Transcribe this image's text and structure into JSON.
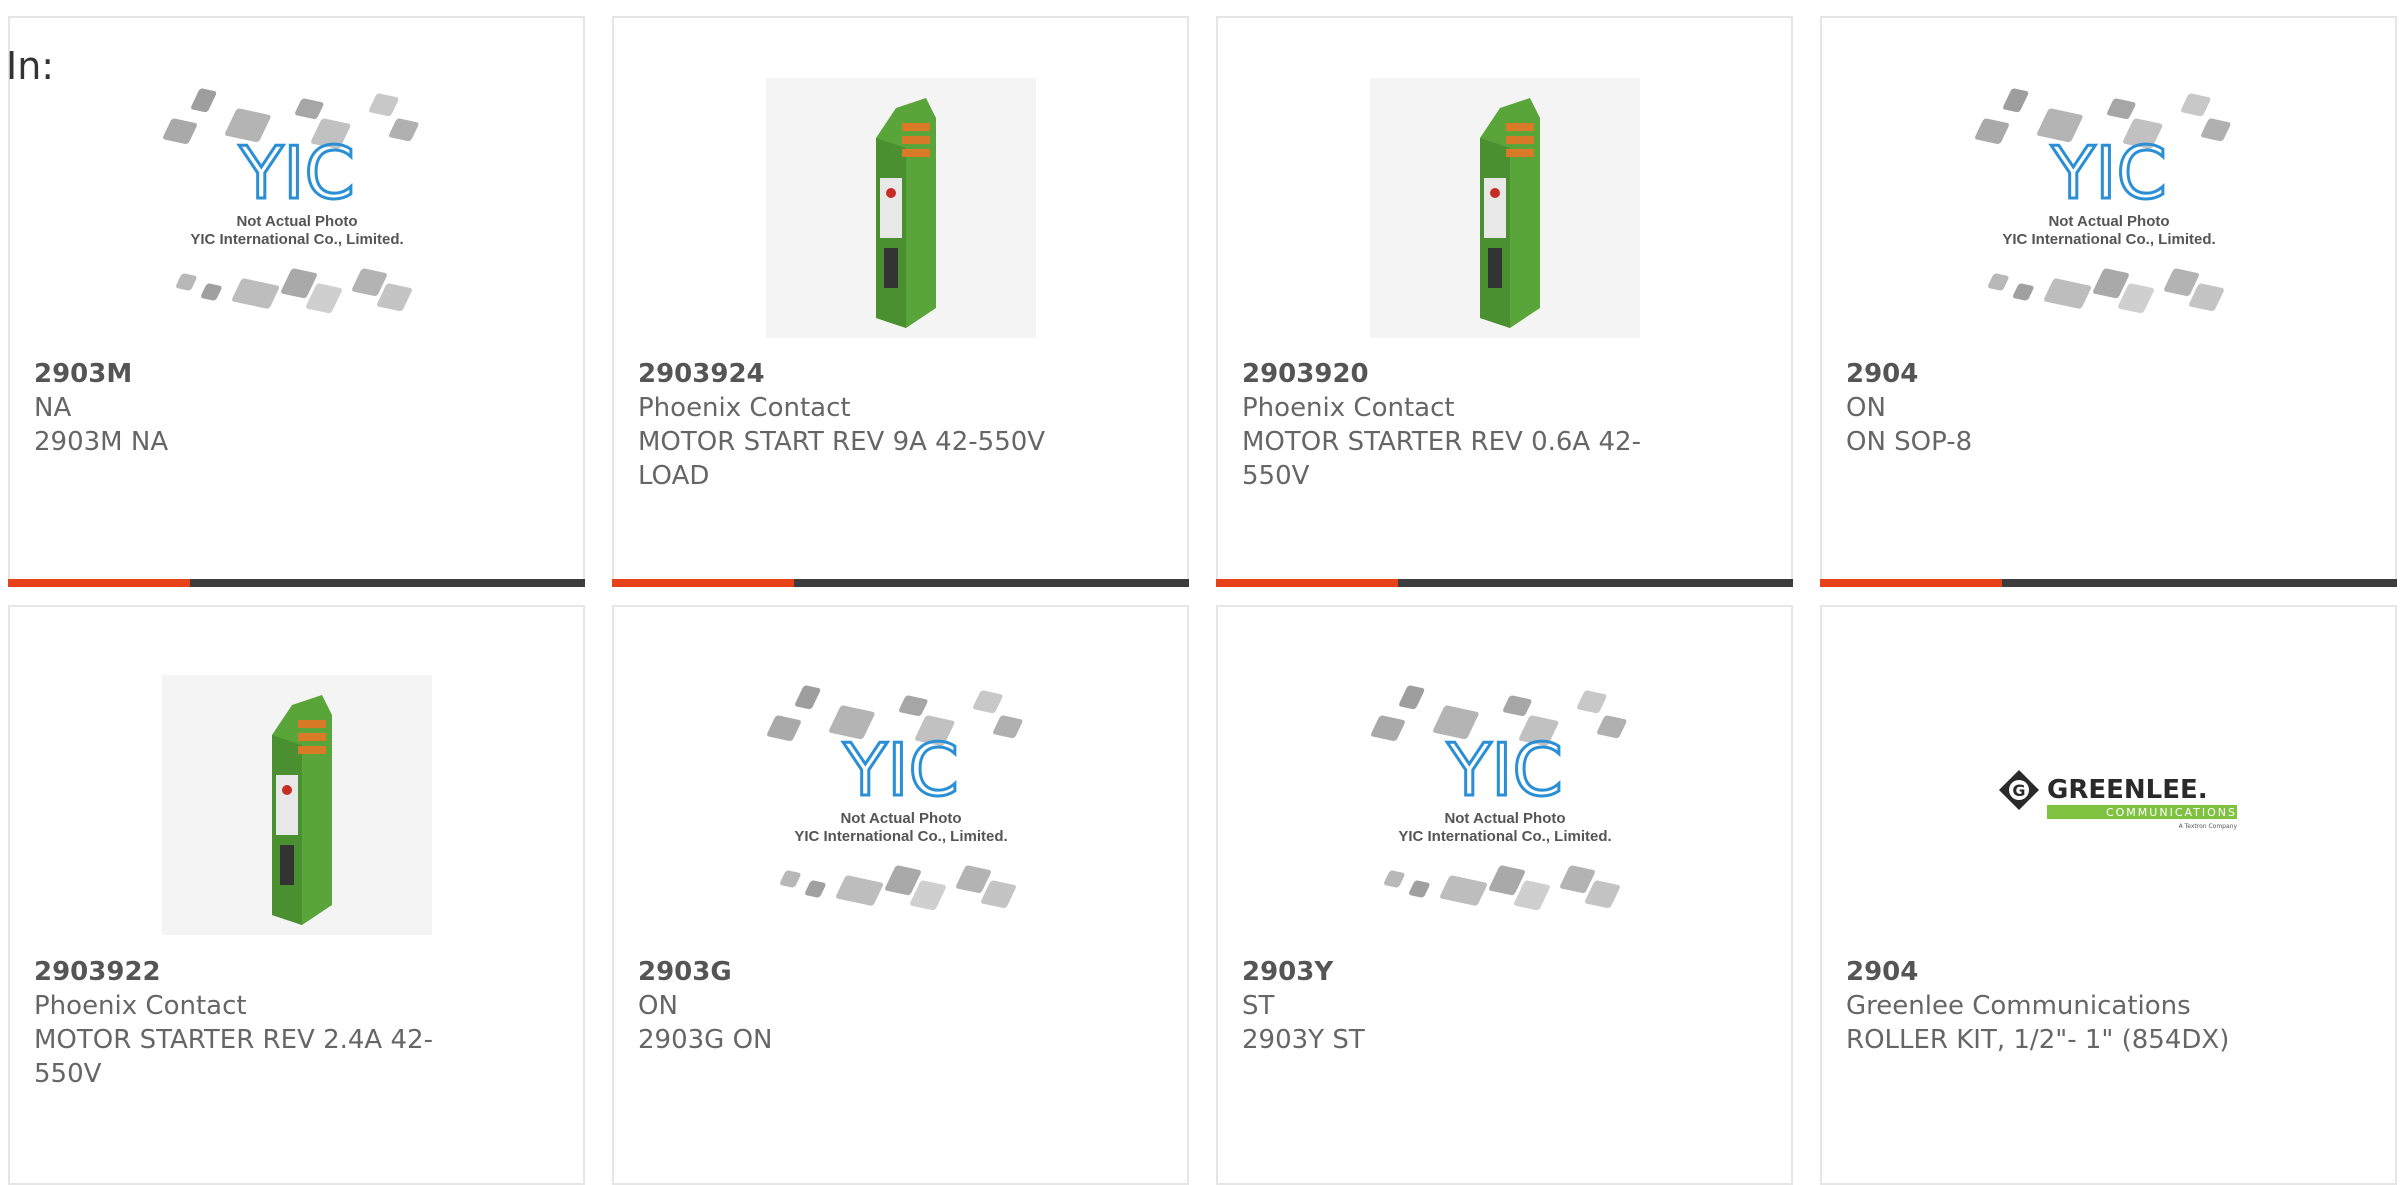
{
  "search": {
    "label": "In:"
  },
  "placeholder": {
    "logo": "YIC",
    "line1": "Not Actual Photo",
    "line2": "YIC International Co., Limited."
  },
  "greenlee_logo": {
    "brand": "GREENLEE.",
    "sub": "COMMUNICATIONS",
    "tag": "A Textron Company"
  },
  "colors": {
    "accent": "#e8421b",
    "bar": "#3d3d3d",
    "border": "#e6e6e6",
    "product_green": "#5aa53a",
    "yic_blue": "#2b8fd6"
  },
  "products": [
    {
      "part": "2903M",
      "mfr": "NA",
      "desc": "2903M NA",
      "image": "placeholder"
    },
    {
      "part": "2903924",
      "mfr": "Phoenix Contact",
      "desc": "MOTOR START REV 9A 42-550V LOAD",
      "image": "motor-starter"
    },
    {
      "part": "2903920",
      "mfr": "Phoenix Contact",
      "desc": "MOTOR STARTER REV 0.6A 42-550V",
      "image": "motor-starter"
    },
    {
      "part": "2904",
      "mfr": "ON",
      "desc": "ON SOP-8",
      "image": "placeholder"
    },
    {
      "part": "2903922",
      "mfr": "Phoenix Contact",
      "desc": "MOTOR STARTER REV 2.4A 42-550V",
      "image": "motor-starter"
    },
    {
      "part": "2903G",
      "mfr": "ON",
      "desc": "2903G ON",
      "image": "placeholder"
    },
    {
      "part": "2903Y",
      "mfr": "ST",
      "desc": "2903Y ST",
      "image": "placeholder"
    },
    {
      "part": "2904",
      "mfr": "Greenlee Communications",
      "desc": "ROLLER KIT, 1/2\"- 1\" (854DX)",
      "image": "greenlee"
    }
  ]
}
